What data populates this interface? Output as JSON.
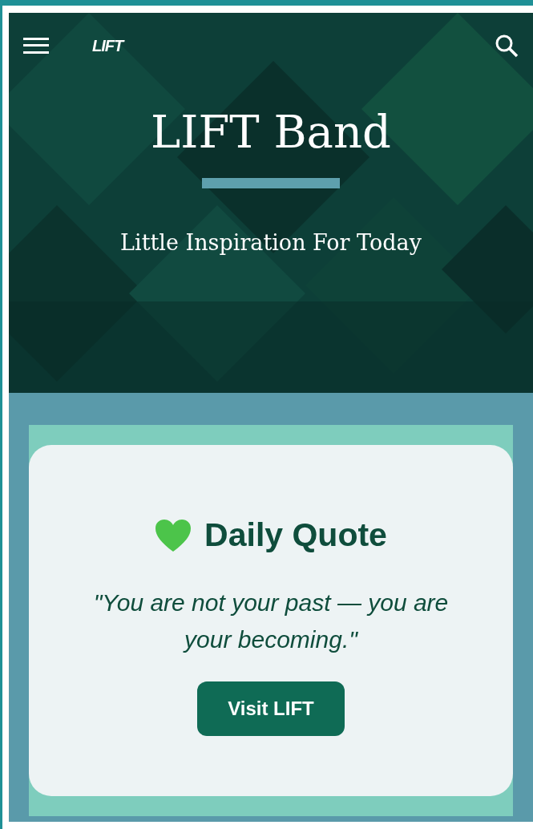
{
  "header": {
    "logo": "LIFT"
  },
  "hero": {
    "title": "LIFT Band",
    "subtitle": "Little Inspiration For Today"
  },
  "quote_card": {
    "title": "Daily Quote",
    "quote": "\"You are not your past — you are your becoming.\"",
    "button": "Visit LIFT"
  }
}
